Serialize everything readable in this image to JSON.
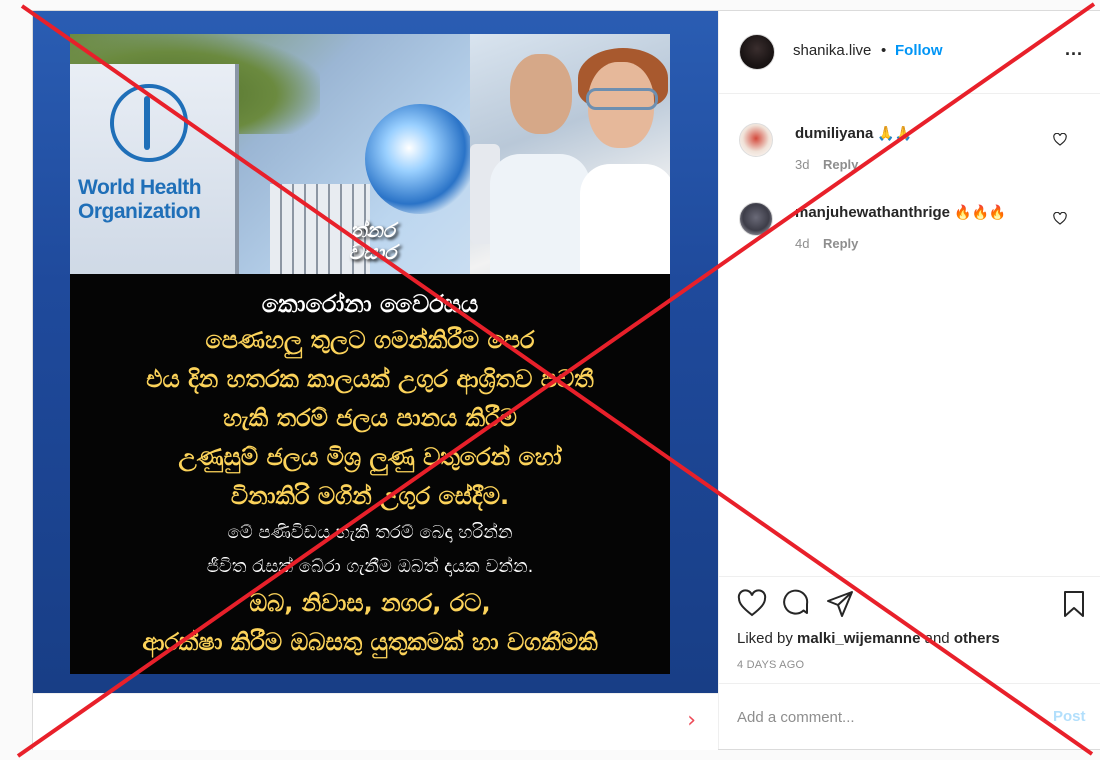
{
  "post": {
    "media": {
      "who_sign_text": "World Health Organization",
      "channel_logo": "ත්නර\nවසාර",
      "caption_lines": [
        {
          "text": "කොරෝනා වෛරසය",
          "style": "white"
        },
        {
          "text": "පෙණහලු තුලට ගමන්කිරීම පෙර",
          "style": "gold"
        },
        {
          "text": "එය දින හතරක කාලයක් උගුර ආශ්‍රිතව පවතී",
          "style": "gold"
        },
        {
          "text": "හැකි තරම් ජලය පානය කිරීම",
          "style": "gold"
        },
        {
          "text": "උණුසුම් ජලය මිශ්‍ර ලුණු වතුරෙන් හෝ",
          "style": "gold"
        },
        {
          "text": "විනාකිරි මගින් උගුර සේදීම.",
          "style": "gold"
        },
        {
          "text": "මේ පණිවිඩය හැකි තරම් බෙදා හරින්න",
          "style": "white-sm"
        },
        {
          "text": "ජීවිත රැසක් බේරා ගැනීම ඔබත් දායක වන්න.",
          "style": "white-sm"
        },
        {
          "text": "ඔබ, නිවාස, නගර, රට,",
          "style": "gold"
        },
        {
          "text": "ආරක්ෂා කිරීම ඔබසතු යුතුකමක් හා වගකීමකි",
          "style": "gold"
        }
      ],
      "next_label": "›"
    },
    "header": {
      "username": "shanika.live",
      "separator": "•",
      "follow_label": "Follow",
      "more_label": "..."
    },
    "comments": [
      {
        "user": "dumiliyana",
        "emoji": "🙏🙏",
        "time": "3d",
        "reply_label": "Reply"
      },
      {
        "user": "manjuhewathanthrige",
        "emoji": "🔥🔥🔥",
        "time": "4d",
        "reply_label": "Reply"
      }
    ],
    "liked": {
      "prefix": "Liked by ",
      "user": "malki_wijemanne",
      "middle": " and ",
      "others": "others"
    },
    "date": "4 DAYS AGO",
    "comment_box": {
      "placeholder": "Add a comment...",
      "post_label": "Post"
    }
  },
  "colors": {
    "accent": "#0095f6",
    "overlay_x": "#e8202a",
    "caption_gold": "#fcd35a"
  }
}
